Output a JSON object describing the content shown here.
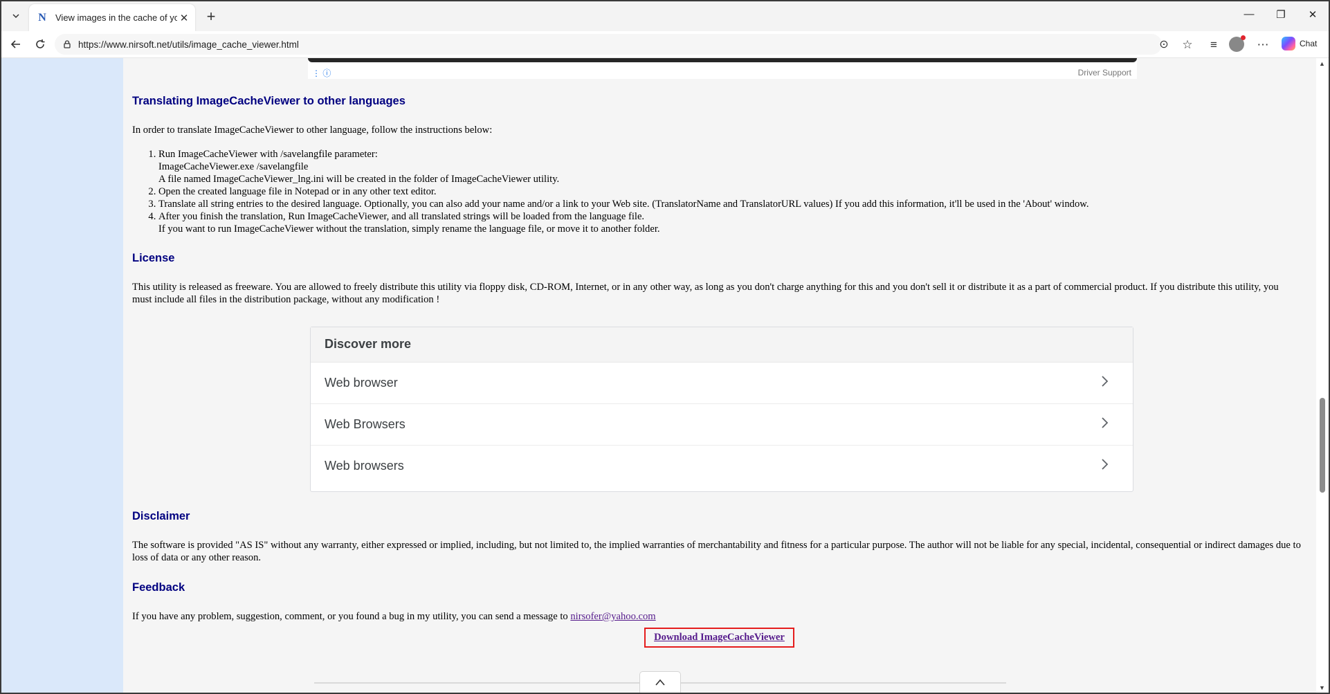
{
  "browser": {
    "tab_title": "View images in the cache of your Web browser",
    "tab_favicon": "N",
    "url": "https://www.nirsoft.net/utils/image_cache_viewer.html",
    "chat_label": "Chat",
    "icons": {
      "tab_list": "chevron-down-icon",
      "close_tab": "close-icon",
      "new_tab": "plus-icon",
      "back": "back-arrow-icon",
      "reload": "reload-icon",
      "site_info": "lock-icon",
      "read_aloud": "read-aloud-icon",
      "favorite": "star-icon",
      "favorites": "favorites-list-icon",
      "profile": "profile-icon",
      "more": "more-icon",
      "copilot": "copilot-icon",
      "minimize": "minimize-icon",
      "restore": "restore-icon",
      "close_window": "close-icon"
    }
  },
  "ad_top": {
    "label": "Driver Support",
    "icons": [
      "more-vertical-icon",
      "info-icon"
    ]
  },
  "sections": {
    "translating": {
      "heading": "Translating ImageCacheViewer to other languages",
      "intro": "In order to translate ImageCacheViewer to other language, follow the instructions below:",
      "steps": [
        {
          "lines": [
            "Run ImageCacheViewer with /savelangfile parameter:",
            "ImageCacheViewer.exe /savelangfile",
            "A file named ImageCacheViewer_lng.ini will be created in the folder of ImageCacheViewer utility."
          ]
        },
        {
          "lines": [
            "Open the created language file in Notepad or in any other text editor."
          ]
        },
        {
          "lines": [
            "Translate all string entries to the desired language. Optionally, you can also add your name and/or a link to your Web site. (TranslatorName and TranslatorURL values) If you add this information, it'll be used in the 'About' window."
          ]
        },
        {
          "lines": [
            "After you finish the translation, Run ImageCacheViewer, and all translated strings will be loaded from the language file.",
            "If you want to run ImageCacheViewer without the translation, simply rename the language file, or move it to another folder."
          ]
        }
      ]
    },
    "license": {
      "heading": "License",
      "text": "This utility is released as freeware. You are allowed to freely distribute this utility via floppy disk, CD-ROM, Internet, or in any other way, as long as you don't charge anything for this and you don't sell it or distribute it as a part of commercial product. If you distribute this utility, you must include all files in the distribution package, without any modification !"
    },
    "discover": {
      "title": "Discover more",
      "items": [
        {
          "label": "Web browser",
          "icon": "chevron-right-icon"
        },
        {
          "label": "Web Browsers",
          "icon": "chevron-right-icon"
        },
        {
          "label": "Web browsers",
          "icon": "chevron-right-icon"
        }
      ]
    },
    "disclaimer": {
      "heading": "Disclaimer",
      "text": "The software is provided \"AS IS\" without any warranty, either expressed or implied, including, but not limited to, the implied warranties of merchantability and fitness for a particular purpose. The author will not be liable for any special, incidental, consequential or indirect damages due to loss of data or any other reason."
    },
    "feedback": {
      "heading": "Feedback",
      "text": "If you have any problem, suggestion, comment, or you found a bug in my utility, you can send a message to",
      "email": "nirsofer@yahoo.com"
    },
    "download_link": "Download ImageCacheViewer"
  },
  "ad_bottom": {
    "toggle_icon": "chevron-up-icon"
  }
}
